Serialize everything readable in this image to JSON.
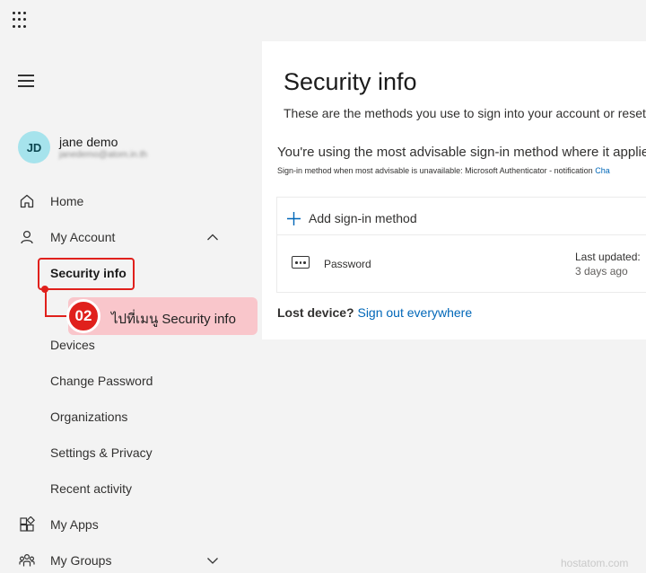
{
  "header": {
    "app_launcher_icon": "waffle-icon"
  },
  "sidebar": {
    "menu_icon": "hamburger-menu-icon",
    "user": {
      "initials": "JD",
      "name": "jane demo",
      "email": "janedemo@atom.in.th"
    },
    "items": [
      {
        "label": "Home",
        "icon": "home-icon"
      },
      {
        "label": "My Account",
        "icon": "person-icon",
        "expander": "chevron-up-icon"
      },
      {
        "label": "Security info",
        "selected": true
      },
      {
        "label": "Devices"
      },
      {
        "label": "Change Password"
      },
      {
        "label": "Organizations"
      },
      {
        "label": "Settings & Privacy"
      },
      {
        "label": "Recent activity"
      },
      {
        "label": "My Apps",
        "icon": "apps-icon"
      },
      {
        "label": "My Groups",
        "icon": "groups-icon",
        "expander": "chevron-down-icon"
      }
    ]
  },
  "annotation": {
    "step": "02",
    "text": "ไปที่เมนู Security info",
    "color": "#e0201c"
  },
  "main": {
    "title": "Security info",
    "description": "These are the methods you use to sign into your account or reset",
    "default_method_line": "You're using the most advisable sign-in method where it applie",
    "default_method_small": "Sign-in method when most advisable is unavailable: Microsoft Authenticator - notification",
    "default_method_small_link": "Cha",
    "add_method_label": "Add sign-in method",
    "methods": [
      {
        "icon": "password-dots-icon",
        "name": "Password",
        "last_updated_label": "Last updated:",
        "last_updated_value": "3 days ago"
      }
    ],
    "lost_device_label": "Lost device?",
    "lost_device_link": "Sign out everywhere"
  },
  "watermark": "hostatom.com",
  "colors": {
    "accent_link": "#0067b8",
    "avatar_bg": "#a6e3ec",
    "annotation_red": "#e0201c",
    "annotation_pink": "#f9c6cb"
  }
}
